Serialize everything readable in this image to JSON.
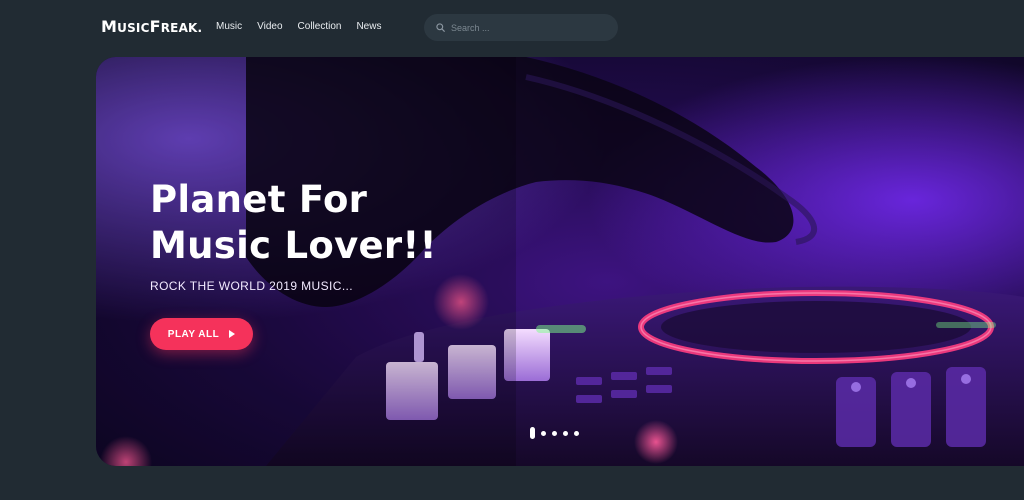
{
  "header": {
    "logo_big": "M",
    "logo_small_1": "usic",
    "logo_big_2": "F",
    "logo_small_2": "reak.",
    "nav": [
      {
        "label": "Music"
      },
      {
        "label": "Video"
      },
      {
        "label": "Collection"
      },
      {
        "label": "News"
      }
    ],
    "search": {
      "placeholder": "Search ...",
      "icon": "search-icon"
    }
  },
  "hero": {
    "title_line1": "Planet For",
    "title_line2": "Music Lover!!",
    "subtitle": "ROCK THE WORLD 2019 MUSIC...",
    "play_button": "PLAY ALL",
    "play_icon": "play-icon",
    "slides": {
      "count": 5,
      "active_index": 0
    }
  },
  "colors": {
    "background": "#212b33",
    "search_bg": "#2c3841",
    "accent": "#f5325b",
    "hero_purple": "#6a1fd1"
  }
}
